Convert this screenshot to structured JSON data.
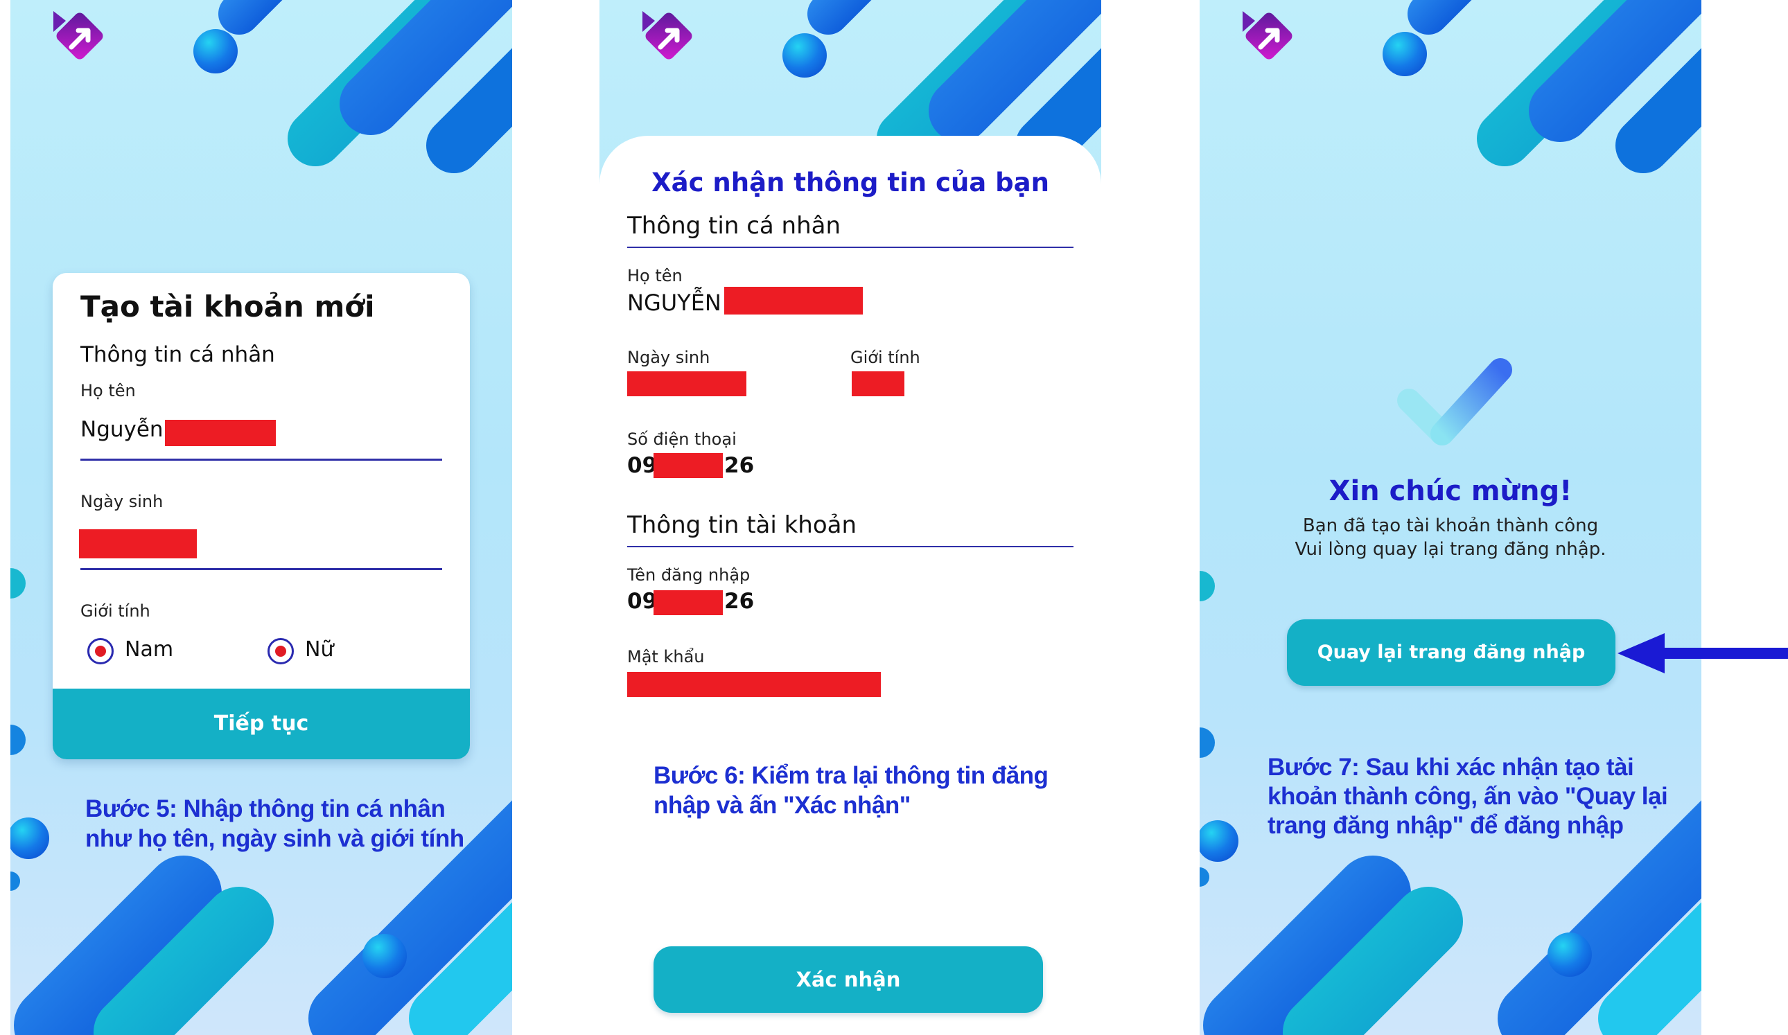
{
  "colors": {
    "accent": "#14b0c6",
    "title_blue": "#1c1cc7",
    "step_blue": "#1c2fd1",
    "redaction": "#ed1c24",
    "underline": "#2f2fa8"
  },
  "screen1": {
    "card_title": "Tạo tài khoản mới",
    "section_title": "Thông tin cá nhân",
    "name_label": "Họ tên",
    "name_value": "Nguyễn",
    "dob_label": "Ngày sinh",
    "gender_label": "Giới tính",
    "gender_male": "Nam",
    "gender_female": "Nữ",
    "continue_button": "Tiếp tục",
    "step_line1": "Bước 5: Nhập thông tin cá nhân",
    "step_line2": "như họ tên, ngày sinh và giới tính"
  },
  "screen2": {
    "sheet_title": "Xác nhận thông tin của bạn",
    "personal_section": "Thông tin cá nhân",
    "name_label": "Họ tên",
    "name_value": "NGUYỄN",
    "dob_label": "Ngày sinh",
    "gender_label": "Giới tính",
    "phone_label": "Số điện thoại",
    "phone_prefix": "09",
    "phone_suffix": "26",
    "account_section": "Thông tin tài khoản",
    "username_label": "Tên đăng nhập",
    "username_prefix": "09",
    "username_suffix": "26",
    "password_label": "Mật khẩu",
    "step_line1": "Bước 6: Kiểm tra lại thông tin đăng",
    "step_line2": "nhập và ấn \"Xác nhận\"",
    "confirm_button": "Xác nhận"
  },
  "screen3": {
    "congrats_title": "Xin chúc mừng!",
    "message_line1": "Bạn đã tạo tài khoản thành công",
    "message_line2": "Vui lòng quay lại trang đăng nhập.",
    "back_button": "Quay lại trang đăng nhập",
    "step_line1": "Bước 7: Sau khi xác nhận tạo tài",
    "step_line2": "khoản thành công, ấn vào \"Quay lại",
    "step_line3": "trang đăng nhập\" để đăng nhập"
  },
  "icons": {
    "logo": "app-logo-icon",
    "check": "checkmark-icon",
    "pointer": "arrow-left-icon"
  }
}
